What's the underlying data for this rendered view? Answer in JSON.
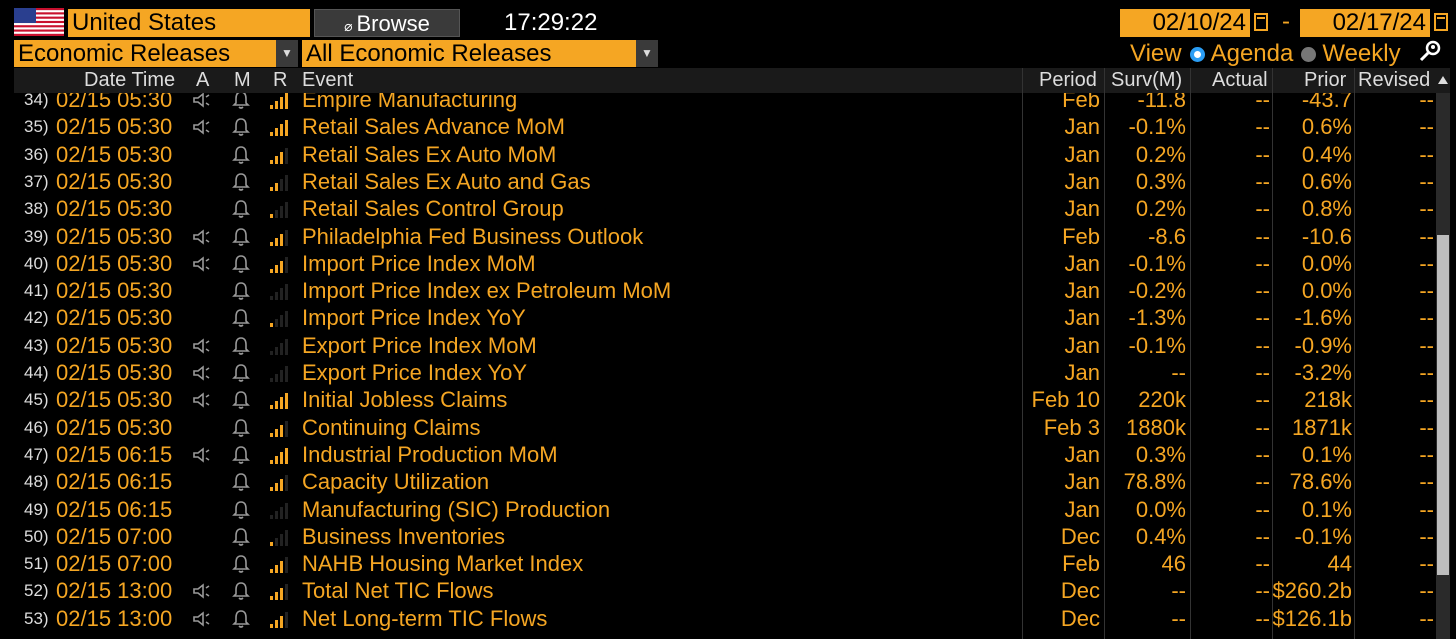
{
  "toolbar": {
    "country": "United States",
    "browse_label": "Browse",
    "clock": "17:29:22",
    "date_from": "02/10/24",
    "date_separator": "-",
    "date_to": "02/17/24",
    "release_type": "Economic Releases",
    "release_filter": "All Economic Releases",
    "view_label": "View",
    "view_options": [
      "Agenda",
      "Weekly"
    ],
    "view_selected": "Agenda"
  },
  "columns": {
    "datetime": "Date Time",
    "alert": "A",
    "monitor": "M",
    "relevance": "R",
    "event": "Event",
    "period": "Period",
    "survey": "Surv(M)",
    "actual": "Actual",
    "prior": "Prior",
    "revised": "Revised"
  },
  "colors": {
    "accent": "#f5a623",
    "background": "#000000",
    "header_bg": "#1a1a1a"
  },
  "rows": [
    {
      "n": "34)",
      "dt": "02/15 05:30",
      "alarm": true,
      "bars": 4,
      "event": "Empire Manufacturing",
      "period": "Feb",
      "surv": "-11.8",
      "actual": "--",
      "prior": "-43.7",
      "revised": "--"
    },
    {
      "n": "35)",
      "dt": "02/15 05:30",
      "alarm": true,
      "bars": 4,
      "event": "Retail Sales Advance MoM",
      "period": "Jan",
      "surv": "-0.1%",
      "actual": "--",
      "prior": "0.6%",
      "revised": "--"
    },
    {
      "n": "36)",
      "dt": "02/15 05:30",
      "alarm": false,
      "bars": 3,
      "event": "Retail Sales Ex Auto MoM",
      "period": "Jan",
      "surv": "0.2%",
      "actual": "--",
      "prior": "0.4%",
      "revised": "--"
    },
    {
      "n": "37)",
      "dt": "02/15 05:30",
      "alarm": false,
      "bars": 2,
      "event": "Retail Sales Ex Auto and Gas",
      "period": "Jan",
      "surv": "0.3%",
      "actual": "--",
      "prior": "0.6%",
      "revised": "--"
    },
    {
      "n": "38)",
      "dt": "02/15 05:30",
      "alarm": false,
      "bars": 1,
      "event": "Retail Sales Control Group",
      "period": "Jan",
      "surv": "0.2%",
      "actual": "--",
      "prior": "0.8%",
      "revised": "--"
    },
    {
      "n": "39)",
      "dt": "02/15 05:30",
      "alarm": true,
      "bars": 3,
      "event": "Philadelphia Fed Business Outlook",
      "period": "Feb",
      "surv": "-8.6",
      "actual": "--",
      "prior": "-10.6",
      "revised": "--"
    },
    {
      "n": "40)",
      "dt": "02/15 05:30",
      "alarm": true,
      "bars": 3,
      "event": "Import Price Index MoM",
      "period": "Jan",
      "surv": "-0.1%",
      "actual": "--",
      "prior": "0.0%",
      "revised": "--"
    },
    {
      "n": "41)",
      "dt": "02/15 05:30",
      "alarm": false,
      "bars": 0,
      "event": "Import Price Index ex Petroleum MoM",
      "period": "Jan",
      "surv": "-0.2%",
      "actual": "--",
      "prior": "0.0%",
      "revised": "--"
    },
    {
      "n": "42)",
      "dt": "02/15 05:30",
      "alarm": false,
      "bars": 1,
      "event": "Import Price Index YoY",
      "period": "Jan",
      "surv": "-1.3%",
      "actual": "--",
      "prior": "-1.6%",
      "revised": "--"
    },
    {
      "n": "43)",
      "dt": "02/15 05:30",
      "alarm": true,
      "bars": 0,
      "event": "Export Price Index MoM",
      "period": "Jan",
      "surv": "-0.1%",
      "actual": "--",
      "prior": "-0.9%",
      "revised": "--"
    },
    {
      "n": "44)",
      "dt": "02/15 05:30",
      "alarm": true,
      "bars": 0,
      "event": "Export Price Index YoY",
      "period": "Jan",
      "surv": "--",
      "actual": "--",
      "prior": "-3.2%",
      "revised": "--"
    },
    {
      "n": "45)",
      "dt": "02/15 05:30",
      "alarm": true,
      "bars": 4,
      "event": "Initial Jobless Claims",
      "period": "Feb 10",
      "surv": "220k",
      "actual": "--",
      "prior": "218k",
      "revised": "--"
    },
    {
      "n": "46)",
      "dt": "02/15 05:30",
      "alarm": false,
      "bars": 3,
      "event": "Continuing Claims",
      "period": "Feb 3",
      "surv": "1880k",
      "actual": "--",
      "prior": "1871k",
      "revised": "--"
    },
    {
      "n": "47)",
      "dt": "02/15 06:15",
      "alarm": true,
      "bars": 4,
      "event": "Industrial Production MoM",
      "period": "Jan",
      "surv": "0.3%",
      "actual": "--",
      "prior": "0.1%",
      "revised": "--"
    },
    {
      "n": "48)",
      "dt": "02/15 06:15",
      "alarm": false,
      "bars": 3,
      "event": "Capacity Utilization",
      "period": "Jan",
      "surv": "78.8%",
      "actual": "--",
      "prior": "78.6%",
      "revised": "--"
    },
    {
      "n": "49)",
      "dt": "02/15 06:15",
      "alarm": false,
      "bars": 0,
      "event": "Manufacturing (SIC) Production",
      "period": "Jan",
      "surv": "0.0%",
      "actual": "--",
      "prior": "0.1%",
      "revised": "--"
    },
    {
      "n": "50)",
      "dt": "02/15 07:00",
      "alarm": false,
      "bars": 1,
      "event": "Business Inventories",
      "period": "Dec",
      "surv": "0.4%",
      "actual": "--",
      "prior": "-0.1%",
      "revised": "--"
    },
    {
      "n": "51)",
      "dt": "02/15 07:00",
      "alarm": false,
      "bars": 3,
      "event": "NAHB Housing Market Index",
      "period": "Feb",
      "surv": "46",
      "actual": "--",
      "prior": "44",
      "revised": "--"
    },
    {
      "n": "52)",
      "dt": "02/15 13:00",
      "alarm": true,
      "bars": 3,
      "event": "Total Net TIC Flows",
      "period": "Dec",
      "surv": "--",
      "actual": "--",
      "prior": "$260.2b",
      "revised": "--"
    },
    {
      "n": "53)",
      "dt": "02/15 13:00",
      "alarm": true,
      "bars": 3,
      "event": "Net Long-term TIC Flows",
      "period": "Dec",
      "surv": "--",
      "actual": "--",
      "prior": "$126.1b",
      "revised": "--"
    }
  ]
}
